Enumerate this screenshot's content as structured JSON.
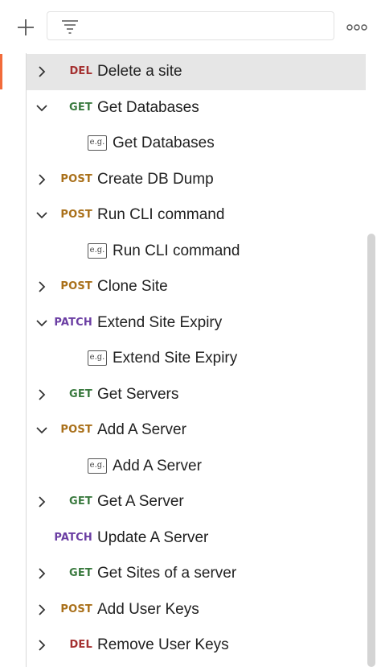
{
  "colors": {
    "accent": "#f26b3a",
    "get": "#3a7a3f",
    "post": "#a9701a",
    "del": "#a43030",
    "patch": "#6b3ea3",
    "selected_bg": "#e6e6e6"
  },
  "toolbar": {
    "add_icon": "plus-icon",
    "filter_icon": "filter-icon",
    "more_icon": "more-horizontal-icon"
  },
  "tree": [
    {
      "chevron": "right",
      "method": "DEL",
      "label": "Delete a site",
      "selected": true
    },
    {
      "chevron": "down",
      "method": "GET",
      "label": "Get Databases"
    },
    {
      "example": true,
      "icon_text": "e.g.",
      "label": "Get Databases"
    },
    {
      "chevron": "right",
      "method": "POST",
      "label": "Create DB Dump"
    },
    {
      "chevron": "down",
      "method": "POST",
      "label": "Run CLI command"
    },
    {
      "example": true,
      "icon_text": "e.g.",
      "label": "Run CLI command"
    },
    {
      "chevron": "right",
      "method": "POST",
      "label": "Clone Site"
    },
    {
      "chevron": "down",
      "method": "PATCH",
      "label": "Extend Site Expiry"
    },
    {
      "example": true,
      "icon_text": "e.g.",
      "label": "Extend Site Expiry"
    },
    {
      "chevron": "right",
      "method": "GET",
      "label": "Get Servers"
    },
    {
      "chevron": "down",
      "method": "POST",
      "label": "Add A Server"
    },
    {
      "example": true,
      "icon_text": "e.g.",
      "label": "Add A Server"
    },
    {
      "chevron": "right",
      "method": "GET",
      "label": "Get A Server"
    },
    {
      "chevron": "none",
      "method": "PATCH",
      "label": "Update A Server"
    },
    {
      "chevron": "right",
      "method": "GET",
      "label": "Get Sites of a server"
    },
    {
      "chevron": "right",
      "method": "POST",
      "label": "Add User Keys"
    },
    {
      "chevron": "right",
      "method": "DEL",
      "label": "Remove User Keys"
    }
  ]
}
